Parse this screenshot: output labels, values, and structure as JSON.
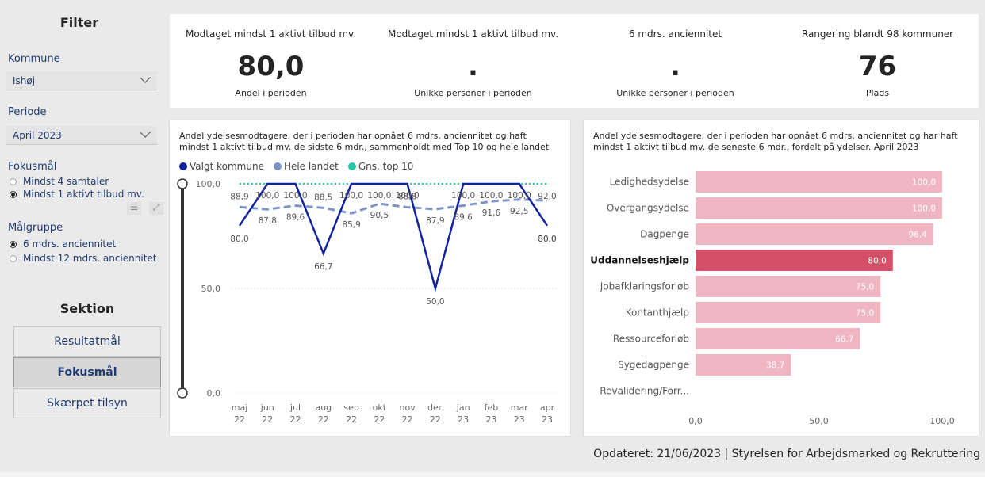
{
  "filter": {
    "title": "Filter",
    "kommune_label": "Kommune",
    "kommune_value": "Ishøj",
    "periode_label": "Periode",
    "periode_value": "April 2023",
    "fokusmaal_label": "Fokusmål",
    "fokusmaal_options": [
      "Mindst 4 samtaler",
      "Mindst 1 aktivt tilbud mv."
    ],
    "fokusmaal_selected": 1,
    "maalgruppe_label": "Målgruppe",
    "maalgruppe_options": [
      "6 mdrs. anciennitet",
      "Mindst 12 mdrs. anciennitet"
    ],
    "maalgruppe_selected": 0
  },
  "sektion": {
    "title": "Sektion",
    "buttons": [
      "Resultatmål",
      "Fokusmål",
      "Skærpet tilsyn"
    ],
    "active": 1
  },
  "kpis": [
    {
      "title": "Modtaget mindst 1 aktivt tilbud mv.",
      "value": "80,0",
      "sub": "Andel i perioden"
    },
    {
      "title": "Modtaget mindst 1 aktivt tilbud mv.",
      "value": ".",
      "sub": "Unikke personer i perioden"
    },
    {
      "title": "6 mdrs. anciennitet",
      "value": ".",
      "sub": "Unikke personer i perioden"
    },
    {
      "title": "Rangering blandt 98 kommuner",
      "value": "76",
      "sub": "Plads"
    }
  ],
  "line_card": {
    "title_1": "Andel ydelsesmodtagere, der i perioden har opnået 6 mdrs. anciennitet og haft",
    "title_2": "mindst 1 aktivt tilbud mv. de sidste 6 mdr., sammenholdt med Top 10 og hele landet"
  },
  "bar_card": {
    "title_1": "Andel ydelsesmodtagere, der i perioden har opnået 6 mdrs. anciennitet og har haft",
    "title_2": "mindst 1 aktivt tilbud mv. de seneste 6 mdr., fordelt på ydelser. April 2023"
  },
  "footer": "Opdateret: 21/06/2023 | Styrelsen for Arbejdsmarked og Rekruttering",
  "colors": {
    "valgt": "#12239e",
    "hele": "#7e93c6",
    "top10": "#26c6a6",
    "bar_light": "#efb6c2",
    "bar_dark": "#d64f69"
  },
  "chart_data": [
    {
      "type": "line",
      "x": [
        "maj 22",
        "jun 22",
        "jul 22",
        "aug 22",
        "sep 22",
        "okt 22",
        "nov 22",
        "dec 22",
        "jan 23",
        "feb 23",
        "mar 23",
        "apr 23"
      ],
      "ylim": [
        0,
        100
      ],
      "yticks": [
        "0,0",
        "50,0",
        "100,0"
      ],
      "legend": "top-left",
      "series": [
        {
          "name": "Valgt kommune",
          "values": [
            80.0,
            100.0,
            100.0,
            66.7,
            100.0,
            100.0,
            100.0,
            50.0,
            100.0,
            100.0,
            100.0,
            80.0
          ],
          "labels": [
            "80,0",
            "100,0",
            "100,0",
            "66,7",
            "100,0",
            "100,0",
            "100,0",
            "50,0",
            "100,0",
            "100,0",
            "100,0",
            "80,0"
          ]
        },
        {
          "name": "Hele landet",
          "values": [
            88.9,
            87.8,
            89.6,
            88.5,
            85.9,
            90.5,
            88.8,
            87.9,
            89.6,
            91.6,
            92.5,
            92.0
          ],
          "labels": [
            "88,9",
            "87,8",
            "89,6",
            "88,5",
            "85,9",
            "90,5",
            "88,8",
            "87,9",
            "89,6",
            "91,6",
            "92,5",
            "92,0"
          ]
        },
        {
          "name": "Gns. top 10",
          "values": [
            100,
            100,
            100,
            100,
            100,
            100,
            100,
            100,
            100,
            100,
            100,
            100
          ]
        }
      ],
      "extra_label": "80,0"
    },
    {
      "type": "bar",
      "orientation": "horizontal",
      "categories": [
        "Ledighedsydelse",
        "Overgangsydelse",
        "Dagpenge",
        "Uddannelseshjælp",
        "Jobafklaringsforløb",
        "Kontanthjælp",
        "Ressourceforløb",
        "Sygedagpenge",
        "Revalidering/Forr..."
      ],
      "values": [
        100.0,
        100.0,
        96.4,
        80.0,
        75.0,
        75.0,
        66.7,
        38.7,
        null
      ],
      "labels": [
        "100,0",
        "100,0",
        "96,4",
        "80,0",
        "75,0",
        "75,0",
        "66,7",
        "38,7",
        ""
      ],
      "highlight": "Uddannelseshjælp",
      "xlim": [
        0,
        100
      ],
      "xticks": [
        "0,0",
        "50,0",
        "100,0"
      ]
    }
  ]
}
